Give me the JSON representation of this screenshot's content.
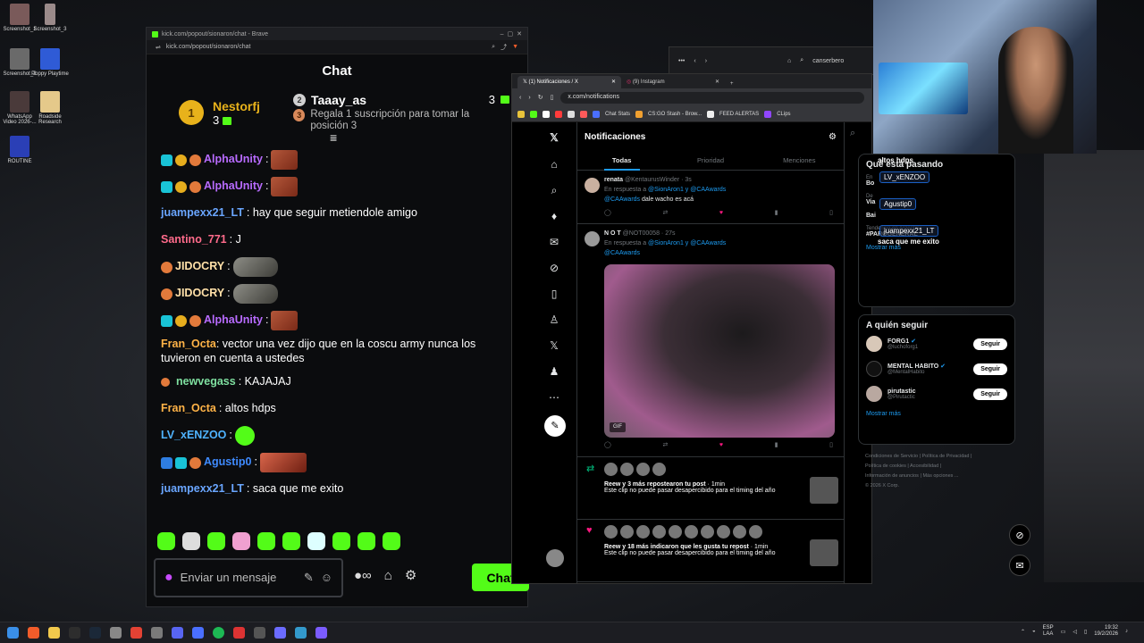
{
  "desktop": {
    "icons": [
      {
        "label": "Screenshot_1",
        "color": "#7a5a5a"
      },
      {
        "label": "Screenshot_3",
        "color": "#9a8a8a"
      },
      {
        "label": "Screenshot_2",
        "color": "#6a6a6a"
      },
      {
        "label": "Poppy Playtime",
        "color": "#2f5bd6"
      },
      {
        "label": "WhatsApp Video 2026-...",
        "color": "#4a3a3a"
      },
      {
        "label": "Roadside Research",
        "color": "#e5c98a"
      },
      {
        "label": "ROUTINE",
        "color": "#2a3fb6"
      }
    ]
  },
  "kick": {
    "tab_title": "kick.com/popout/sionaron/chat - Brave",
    "url": "kick.com/popout/sionaron/chat",
    "chat_title": "Chat",
    "leader1": {
      "rank": "1",
      "name": "Nestorfj",
      "count": "3"
    },
    "leader2": {
      "rank": "2",
      "name": "Taaay_as",
      "count": "3"
    },
    "leader3": {
      "rank": "3",
      "text": "Regala 1 suscripción para tomar la posición 3"
    },
    "messages": [
      {
        "user": "AlphaUnity",
        "color": "#b86bff",
        "text": ":"
      },
      {
        "user": "AlphaUnity",
        "color": "#b86bff",
        "text": ":"
      },
      {
        "user": "juampexx21_LT",
        "color": "#6aa6ff",
        "text": ": hay que seguir metiendole amigo"
      },
      {
        "user": "Santino_771",
        "color": "#ff6b8b",
        "text": ": J"
      },
      {
        "user": "JIDOCRY",
        "color": "#ffe0a8",
        "text": ":"
      },
      {
        "user": "JIDOCRY",
        "color": "#ffe0a8",
        "text": ":"
      },
      {
        "user": "AlphaUnity",
        "color": "#b86bff",
        "text": ":"
      },
      {
        "user": "Fran_Octa",
        "color": "#ffb347",
        "text": ": vector una vez dijo que en la coscu army nunca los tuvieron en cuenta a ustedes"
      },
      {
        "user": "newvegass",
        "color": "#7fe0a0",
        "text": ": KAJAJAJ"
      },
      {
        "user": "Fran_Octa",
        "color": "#ffb347",
        "text": ": altos hdps"
      },
      {
        "user": "LV_xENZOO",
        "color": "#4fb3ff",
        "text": ":"
      },
      {
        "user": "Agustip0",
        "color": "#3f8bff",
        "text": ":"
      },
      {
        "user": "juampexx21_LT",
        "color": "#6aa6ff",
        "text": ": saca que me exito"
      }
    ],
    "input_placeholder": "Enviar un mensaje",
    "send_label": "Chat",
    "accent": "#53fc18"
  },
  "bg_window": {
    "search_text": "canserbero"
  },
  "x": {
    "tab1": "(1) Notificaciones / X",
    "tab2": "(9) Instagram",
    "url": "x.com/notifications",
    "bookmarks": [
      "Chat Stats",
      "CS:GO Stash - Brow...",
      "FEED ALERTAS",
      "CLips"
    ],
    "header": "Notificaciones",
    "tabs": [
      "Todas",
      "Prioridad",
      "Menciones"
    ],
    "tweet1": {
      "name": "renata",
      "handle": "@KentaurusWinder · 3s",
      "reply_prefix": "En respuesta a",
      "reply_to": "@SionAron1 y @CAAwards",
      "mention": "@CAAwards",
      "text": "dale wacho es acá"
    },
    "tweet2": {
      "name": "N O T",
      "handle": "@NOT00058 · 27s",
      "reply_prefix": "En respuesta a",
      "reply_to": "@SionAron1 y @CAAwards",
      "mention": "@CAAwards",
      "gif_label": "GIF"
    },
    "notif1": {
      "text": "Reew y 3 más repostearon tu post",
      "time": "· 1min",
      "sub": "Este clip no puede pasar desapercibido para el timing del año"
    },
    "notif2": {
      "text": "Reew y 18 más indicaron que les gusta tu repost",
      "time": "· 1min",
      "sub": "Este clip no puede pasar desapercibido para el timing del año"
    },
    "accent": "#1d9bf0"
  },
  "trends": {
    "title": "Qué está pasando",
    "items": [
      {
        "meta": "En",
        "name": "Bo"
      },
      {
        "meta": "De",
        "name": "Via"
      },
      {
        "meta": "",
        "name": "Bai"
      },
      {
        "meta": "Tendencia en Argentina",
        "name": "#PAROGENERAL"
      }
    ],
    "show_more": "Mostrar más"
  },
  "follow": {
    "title": "A quién seguir",
    "users": [
      {
        "name": "FORG1",
        "handle": "@luchoforg1",
        "button": "Seguir"
      },
      {
        "name": "MENTAL HABITO",
        "handle": "@MentalHabito",
        "button": "Seguir"
      },
      {
        "name": "pirutastic",
        "handle": "@Pirutactic",
        "button": "Seguir"
      }
    ],
    "show_more": "Mostrar más",
    "footer": [
      "Condiciones de Servicio",
      "Política de Privacidad",
      "Política de cookies",
      "Accesibilidad",
      "Información de anuncios",
      "Más opciones ...",
      "© 2026 X Corp."
    ]
  },
  "overlay": [
    {
      "text": "altos hdps"
    },
    {
      "text": "LV_xENZOO"
    },
    {
      "text": "Agustip0"
    },
    {
      "text": "juampexx21_LT"
    },
    {
      "text": "saca que me exito"
    }
  ],
  "taskbar": {
    "lang": "ESP",
    "lang2": "LAA",
    "time": "19:32",
    "date": "19/2/2026"
  }
}
